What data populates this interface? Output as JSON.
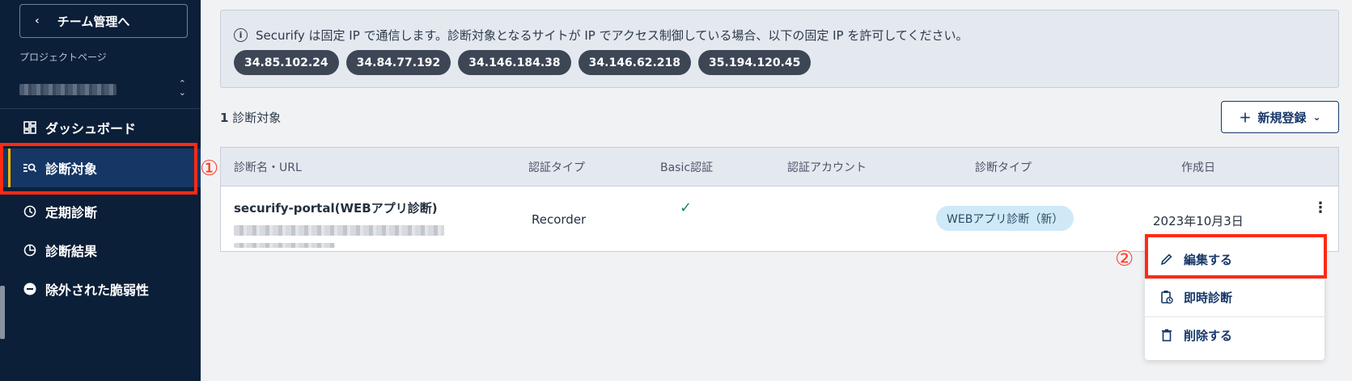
{
  "sidebar": {
    "back_label": "チーム管理へ",
    "project_label": "プロジェクトページ",
    "nav": [
      {
        "label": "ダッシュボード",
        "icon": "dashboard-icon"
      },
      {
        "label": "診断対象",
        "icon": "search-list-icon",
        "active": true
      },
      {
        "label": "定期診断",
        "icon": "clock-icon"
      },
      {
        "label": "診断結果",
        "icon": "pie-chart-icon"
      },
      {
        "label": "除外された脆弱性",
        "icon": "minus-circle-icon"
      }
    ]
  },
  "banner": {
    "message": "Securify は固定 IP で通信します。診断対象となるサイトが IP でアクセス制御している場合、以下の固定 IP を許可してください。",
    "ips": [
      "34.85.102.24",
      "34.84.77.192",
      "34.146.184.38",
      "34.146.62.218",
      "35.194.120.45"
    ]
  },
  "count": {
    "number": "1",
    "label": "診断対象"
  },
  "new_button": {
    "label": "新規登録"
  },
  "table": {
    "headers": [
      "診断名・URL",
      "認証タイプ",
      "Basic認証",
      "認証アカウント",
      "診断タイプ",
      "作成日"
    ],
    "rows": [
      {
        "name": "securify-portal(WEBアプリ診断)",
        "auth_type": "Recorder",
        "basic_auth": "✓",
        "auth_account": "",
        "scan_type": "WEBアプリ診断（新）",
        "created": "2023年10月3日"
      }
    ]
  },
  "annotations": {
    "one": "①",
    "two": "②"
  },
  "menu": {
    "items": [
      {
        "label": "編集する",
        "icon": "pencil-icon"
      },
      {
        "label": "即時診断",
        "icon": "clipboard-clock-icon"
      },
      {
        "label": "削除する",
        "icon": "trash-icon"
      }
    ]
  },
  "colors": {
    "sidebar_bg": "#0c1f38",
    "active_bg": "#163766",
    "accent_yellow": "#f5b800",
    "highlight_red": "#ff2a14",
    "primary_navy": "#17386a"
  }
}
